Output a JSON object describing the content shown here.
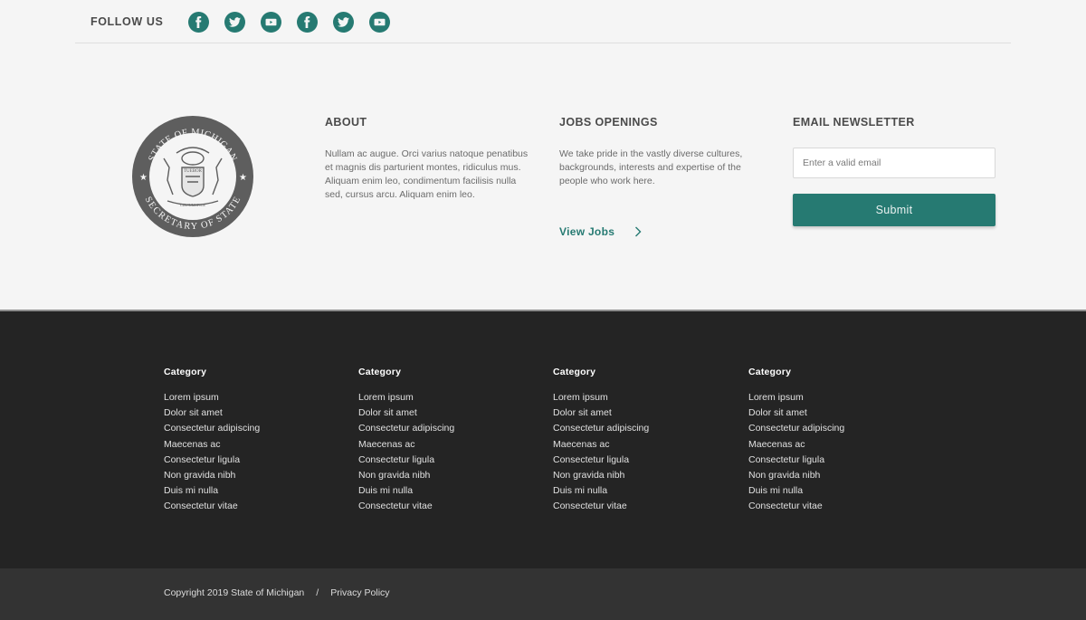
{
  "social": {
    "label": "FOLLOW US",
    "links": [
      {
        "icon": "facebook-icon",
        "name": "Facebook"
      },
      {
        "icon": "twitter-icon",
        "name": "Twitter"
      },
      {
        "icon": "youtube-icon",
        "name": "YouTube"
      },
      {
        "icon": "facebook-icon",
        "name": "Facebook"
      },
      {
        "icon": "twitter-icon",
        "name": "Twitter"
      },
      {
        "icon": "youtube-icon",
        "name": "YouTube"
      }
    ],
    "color": "#267a72"
  },
  "seal": {
    "top_text": "STATE OF MICHIGAN",
    "bottom_text": "SECRETARY OF STATE",
    "motto": "TUEBOR",
    "ribbon": "CIRCUMSPICE"
  },
  "about": {
    "title": "ABOUT",
    "text": "Nullam ac augue. Orci varius natoque penatibus et magnis dis parturient montes, ridiculus mus. Aliquam enim leo, condimentum facilisis nulla sed, cursus arcu. Aliquam enim leo."
  },
  "jobs": {
    "title": "JOBS OPENINGS",
    "text": "We take pride in the vastly diverse cultures, backgrounds, interests and expertise of the people who work here.",
    "link_label": "View Jobs"
  },
  "newsletter": {
    "title": "EMAIL NEWSLETTER",
    "placeholder": "Enter a valid email",
    "value": "",
    "submit_label": "Submit"
  },
  "categories": [
    {
      "title": "Category",
      "items": [
        "Lorem ipsum",
        "Dolor sit amet",
        "Consectetur adipiscing",
        "Maecenas ac",
        "Consectetur ligula",
        "Non gravida nibh",
        "Duis mi nulla",
        "Consectetur vitae"
      ]
    },
    {
      "title": "Category",
      "items": [
        "Lorem ipsum",
        "Dolor sit amet",
        "Consectetur adipiscing",
        "Maecenas ac",
        "Consectetur ligula",
        "Non gravida nibh",
        "Duis mi nulla",
        "Consectetur vitae"
      ]
    },
    {
      "title": "Category",
      "items": [
        "Lorem ipsum",
        "Dolor sit amet",
        "Consectetur adipiscing",
        "Maecenas ac",
        "Consectetur ligula",
        "Non gravida nibh",
        "Duis mi nulla",
        "Consectetur vitae"
      ]
    },
    {
      "title": "Category",
      "items": [
        "Lorem ipsum",
        "Dolor sit amet",
        "Consectetur adipiscing",
        "Maecenas ac",
        "Consectetur ligula",
        "Non gravida nibh",
        "Duis mi nulla",
        "Consectetur vitae"
      ]
    }
  ],
  "legal": {
    "copyright": "Copyright 2019 State of Michigan",
    "separator": "/",
    "privacy_label": "Privacy Policy"
  }
}
